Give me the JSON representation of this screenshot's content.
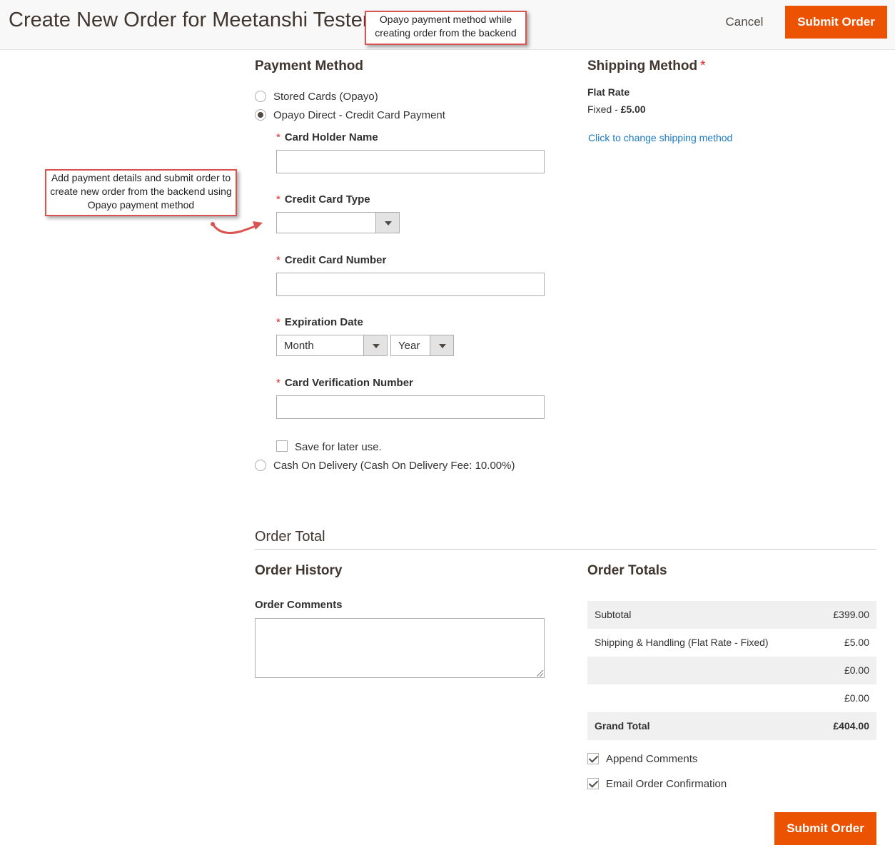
{
  "header": {
    "title": "Create New Order for Meetanshi Tester",
    "cancel_label": "Cancel",
    "submit_label": "Submit Order"
  },
  "callouts": {
    "top": "Opayo payment method while creating order from the backend",
    "left": "Add payment details and submit order to create new order from the backend using Opayo payment method"
  },
  "payment": {
    "title": "Payment Method",
    "options": [
      {
        "label": "Stored Cards (Opayo)",
        "checked": false
      },
      {
        "label": "Opayo Direct - Credit Card Payment",
        "checked": true
      },
      {
        "label": "Cash On Delivery (Cash On Delivery Fee: 10.00%)",
        "checked": false
      }
    ],
    "card_holder_label": "Card Holder Name",
    "card_type_label": "Credit Card Type",
    "card_number_label": "Credit Card Number",
    "expiration_label": "Expiration Date",
    "month_value": "Month",
    "year_value": "Year",
    "cvv_label": "Card Verification Number",
    "save_label": "Save for later use."
  },
  "shipping": {
    "title": "Shipping Method",
    "method_name": "Flat Rate",
    "price_prefix": "Fixed - ",
    "price": "£5.00",
    "change_link": "Click to change shipping method"
  },
  "order_total": {
    "title": "Order Total",
    "history_title": "Order History",
    "comments_label": "Order Comments",
    "totals_title": "Order Totals",
    "rows": [
      {
        "label": "Subtotal",
        "amount": "£399.00"
      },
      {
        "label": "Shipping & Handling (Flat Rate - Fixed)",
        "amount": "£5.00"
      },
      {
        "label": "",
        "amount": "£0.00"
      },
      {
        "label": "",
        "amount": "£0.00"
      },
      {
        "label": "Grand Total",
        "amount": "£404.00"
      }
    ],
    "append_comments_label": "Append Comments",
    "email_confirmation_label": "Email Order Confirmation"
  },
  "colors": {
    "accent": "#eb5202",
    "link": "#1979c3",
    "required": "#e22626",
    "callout_border": "#d9534f"
  }
}
